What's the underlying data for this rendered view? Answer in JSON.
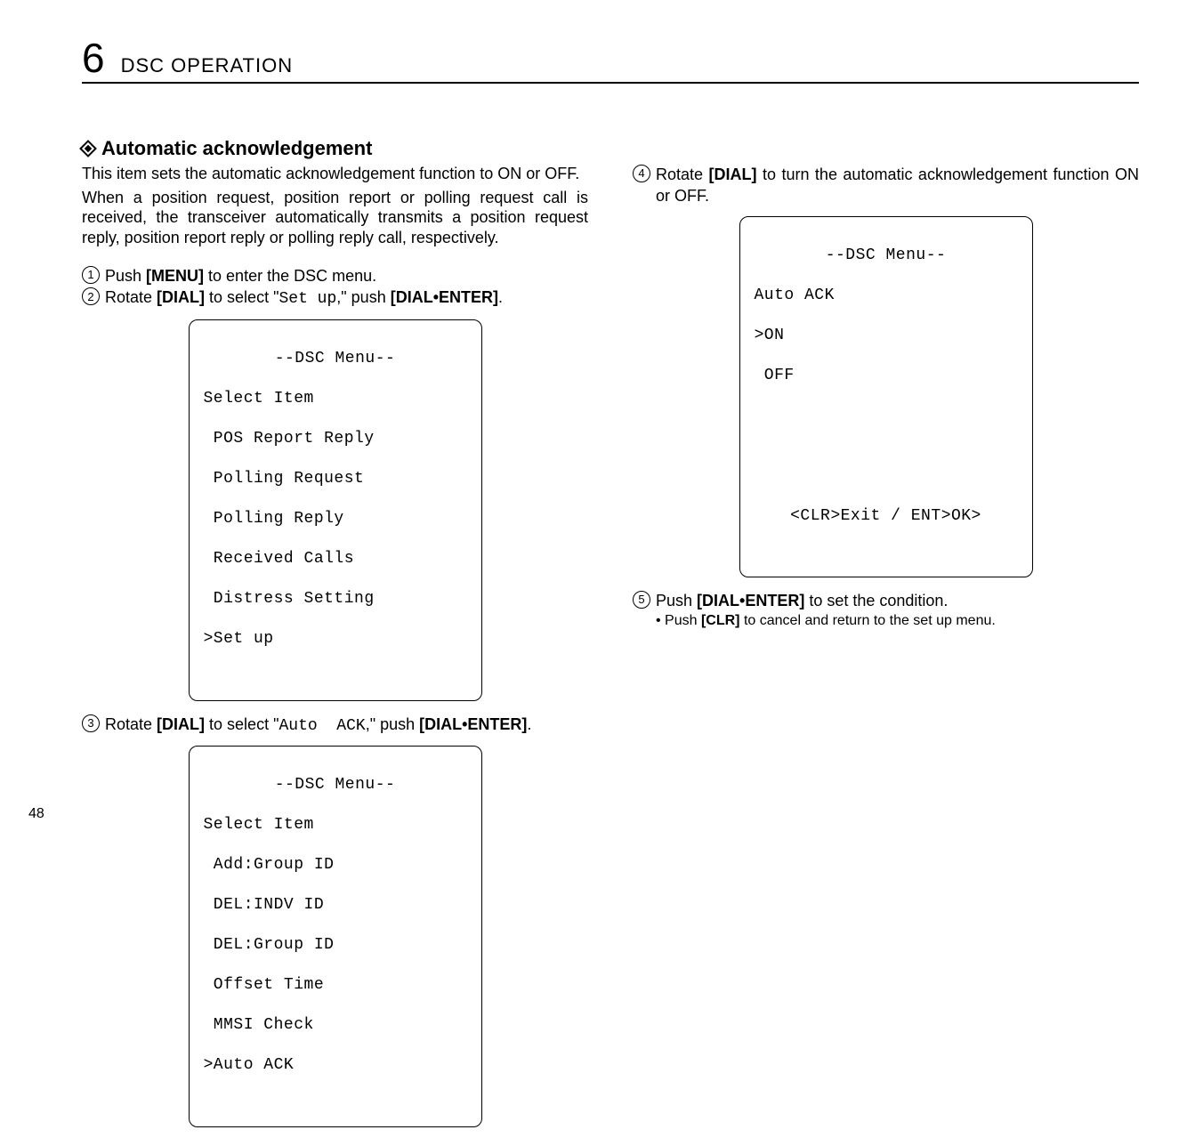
{
  "chapter": {
    "number": "6",
    "title": "DSC OPERATION"
  },
  "section": {
    "heading": "Automatic acknowledgement"
  },
  "left": {
    "intro1": "This item sets the automatic acknowledgement function to ON or OFF.",
    "intro2": "When a position request, position report or polling request call is received, the transceiver automatically transmits a position request reply, position report reply or polling reply call, respectively.",
    "step1_num": "1",
    "step1_a": "Push ",
    "step1_b": "[MENU]",
    "step1_c": " to enter the DSC menu.",
    "step2_num": "2",
    "step2_a": "Rotate ",
    "step2_b": "[DIAL]",
    "step2_c": " to select \"",
    "step2_mono": "Set up",
    "step2_d": ",\" push ",
    "step2_e": "[DIAL•ENTER]",
    "step2_f": ".",
    "lcd1": {
      "title": "--DSC Menu--",
      "l1": "Select Item",
      "l2": " POS Report Reply",
      "l3": " Polling Request",
      "l4": " Polling Reply",
      "l5": " Received Calls",
      "l6": " Distress Setting",
      "l7": "˃Set up"
    },
    "step3_num": "3",
    "step3_a": "Rotate ",
    "step3_b": "[DIAL]",
    "step3_c": " to select \"",
    "step3_mono": "Auto  ACK",
    "step3_d": ",\" push ",
    "step3_e": "[DIAL•ENTER]",
    "step3_f": ".",
    "lcd2": {
      "title": "--DSC Menu--",
      "l1": "Select Item",
      "l2": " Add:Group ID",
      "l3": " DEL:INDV ID",
      "l4": " DEL:Group ID",
      "l5": " Offset Time",
      "l6": " MMSI Check",
      "l7": "˃Auto ACK"
    }
  },
  "right": {
    "step4_num": "4",
    "step4_a": "Rotate ",
    "step4_b": "[DIAL]",
    "step4_c": " to turn the automatic acknowledgement function ON or OFF.",
    "lcd3": {
      "title": "--DSC Menu--",
      "l1": "Auto ACK",
      "l2": "˃ON",
      "l3": " OFF",
      "footer": "<CLR˃Exit / ENT˃OK>"
    },
    "step5_num": "5",
    "step5_a": "Push ",
    "step5_b": "[DIAL•ENTER]",
    "step5_c": " to set the condition.",
    "sub_a": "• Push ",
    "sub_b": "[CLR]",
    "sub_c": " to cancel and return to the set up menu."
  },
  "page_number": "48"
}
